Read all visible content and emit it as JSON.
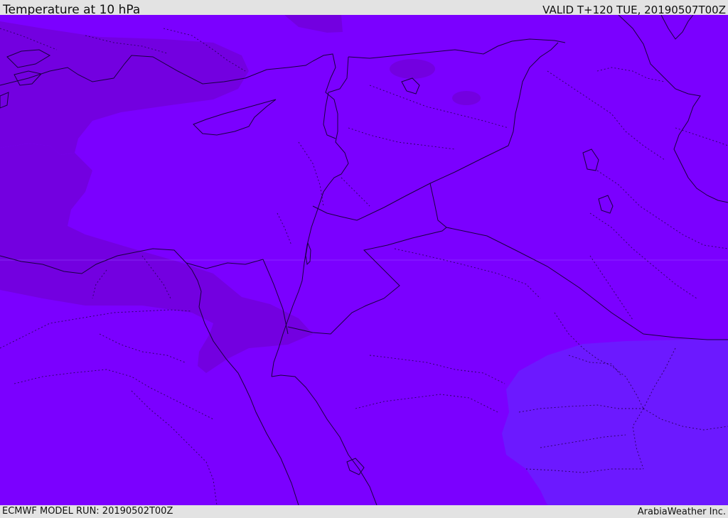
{
  "header": {
    "title": "Temperature at 10 hPa",
    "valid_time": "VALID T+120 TUE, 20190507T00Z"
  },
  "footer": {
    "model_run": "ECMWF MODEL RUN: 20190502T00Z",
    "credit": "ArabiaWeather Inc."
  },
  "colors": {
    "base_fill": "#7b00ff",
    "cooler_band": "#7300e0",
    "warmer_region": "#6c19ff",
    "border_line": "#1a0040"
  }
}
